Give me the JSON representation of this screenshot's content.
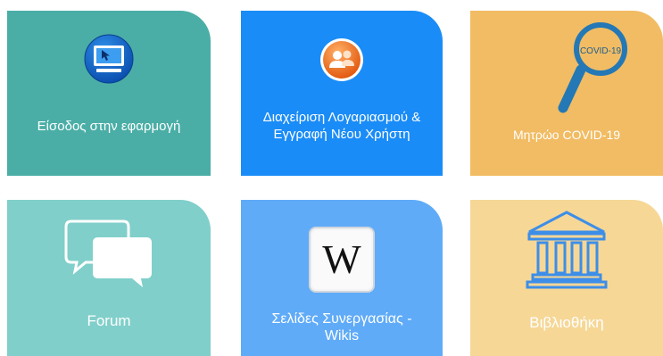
{
  "tiles": [
    {
      "label": "Είσοδος στην εφαρμογή",
      "icon": "monitor-cursor-icon",
      "color": "#4aaea6"
    },
    {
      "label_line1": "Διαχείριση Λογαριασμού &",
      "label_line2": "Εγγραφή Νέου Χρήστη",
      "icon": "users-icon",
      "color": "#1a8cf7"
    },
    {
      "label": "Μητρώο COVID-19",
      "icon": "magnifier-covid-icon",
      "icon_text": "COVID-19",
      "color": "#f1bc63"
    },
    {
      "label": "Forum",
      "icon": "chat-bubbles-icon",
      "color": "#80cfca"
    },
    {
      "label_line1": "Σελίδες Συνεργασίας -",
      "label_line2": "Wikis",
      "icon": "wikipedia-icon",
      "icon_text": "W",
      "color": "#5fabf8"
    },
    {
      "label": "Βιβλιοθήκη",
      "icon": "library-building-icon",
      "color": "#f6d796"
    }
  ]
}
